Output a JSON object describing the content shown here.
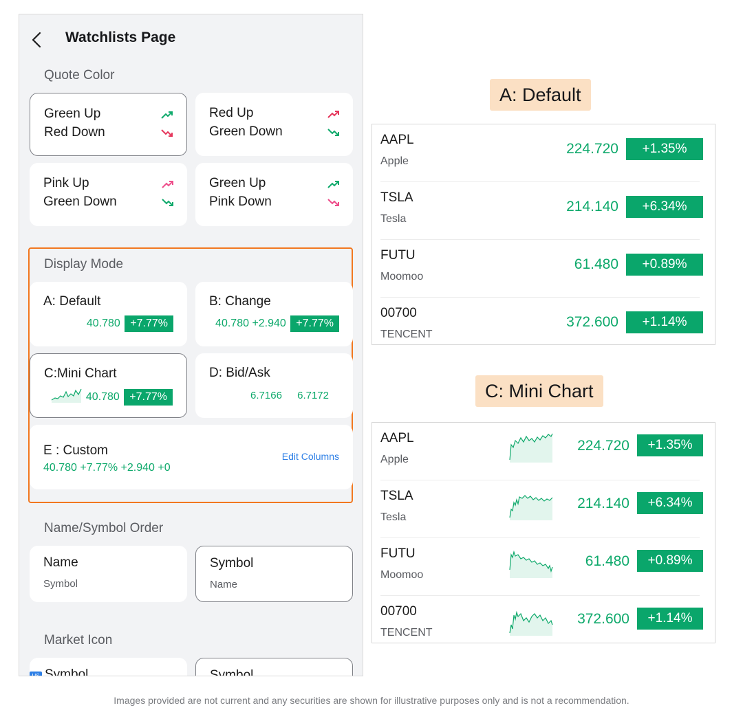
{
  "header": {
    "title": "Watchlists Page"
  },
  "quote_color": {
    "title": "Quote Color",
    "options": [
      {
        "line1": "Green Up",
        "line2": "Red Down",
        "up_color": "#0ea96b",
        "down_color": "#e5365b",
        "selected": true
      },
      {
        "line1": "Red Up",
        "line2": "Green Down",
        "up_color": "#e5365b",
        "down_color": "#0ea96b",
        "selected": false
      },
      {
        "line1": "Pink Up",
        "line2": "Green Down",
        "up_color": "#ee4d8a",
        "down_color": "#0ea96b",
        "selected": false
      },
      {
        "line1": "Green Up",
        "line2": "Pink Down",
        "up_color": "#0ea96b",
        "down_color": "#ee4d8a",
        "selected": false
      }
    ]
  },
  "display_mode": {
    "title": "Display Mode",
    "a": {
      "name": "A: Default",
      "price": "40.780",
      "change_pct": "+7.77%"
    },
    "b": {
      "name": "B: Change",
      "price": "40.780",
      "change": "+2.940",
      "change_pct": "+7.77%"
    },
    "c": {
      "name": "C:Mini Chart",
      "price": "40.780",
      "change_pct": "+7.77%"
    },
    "d": {
      "name": "D: Bid/Ask",
      "bid": "6.7166",
      "ask": "6.7172"
    },
    "e": {
      "name": "E : Custom",
      "values": "40.780 +7.77% +2.940 +0",
      "edit_label": "Edit Columns"
    }
  },
  "name_symbol_order": {
    "title": "Name/Symbol Order",
    "options": [
      {
        "main": "Name",
        "sub": "Symbol",
        "selected": false
      },
      {
        "main": "Symbol",
        "sub": "Name",
        "selected": true
      }
    ]
  },
  "market_icon": {
    "title": "Market Icon",
    "options": [
      {
        "label": "Symbol",
        "badge": "US"
      },
      {
        "label": "Symbol"
      }
    ]
  },
  "panel_default": {
    "tag": "A: Default",
    "rows": [
      {
        "symbol": "AAPL",
        "name": "Apple",
        "price": "224.720",
        "change": "+1.35%"
      },
      {
        "symbol": "TSLA",
        "name": "Tesla",
        "price": "214.140",
        "change": "+6.34%"
      },
      {
        "symbol": "FUTU",
        "name": "Moomoo",
        "price": "61.480",
        "change": "+0.89%"
      },
      {
        "symbol": "00700",
        "name": "TENCENT",
        "price": "372.600",
        "change": "+1.14%"
      }
    ]
  },
  "panel_mini": {
    "tag": "C: Mini Chart",
    "rows": [
      {
        "symbol": "AAPL",
        "name": "Apple",
        "price": "224.720",
        "change": "+1.35%"
      },
      {
        "symbol": "TSLA",
        "name": "Tesla",
        "price": "214.140",
        "change": "+6.34%"
      },
      {
        "symbol": "FUTU",
        "name": "Moomoo",
        "price": "61.480",
        "change": "+0.89%"
      },
      {
        "symbol": "00700",
        "name": "TENCENT",
        "price": "372.600",
        "change": "+1.14%"
      }
    ]
  },
  "disclaimer": "Images provided are not current and any securities are shown for illustrative purposes only and is not a recommendation.",
  "colors": {
    "accent_green": "#0aa66b",
    "highlight_orange": "#f2771f",
    "link_blue": "#2d7fe6",
    "tag_bg": "#fbe0c4"
  }
}
